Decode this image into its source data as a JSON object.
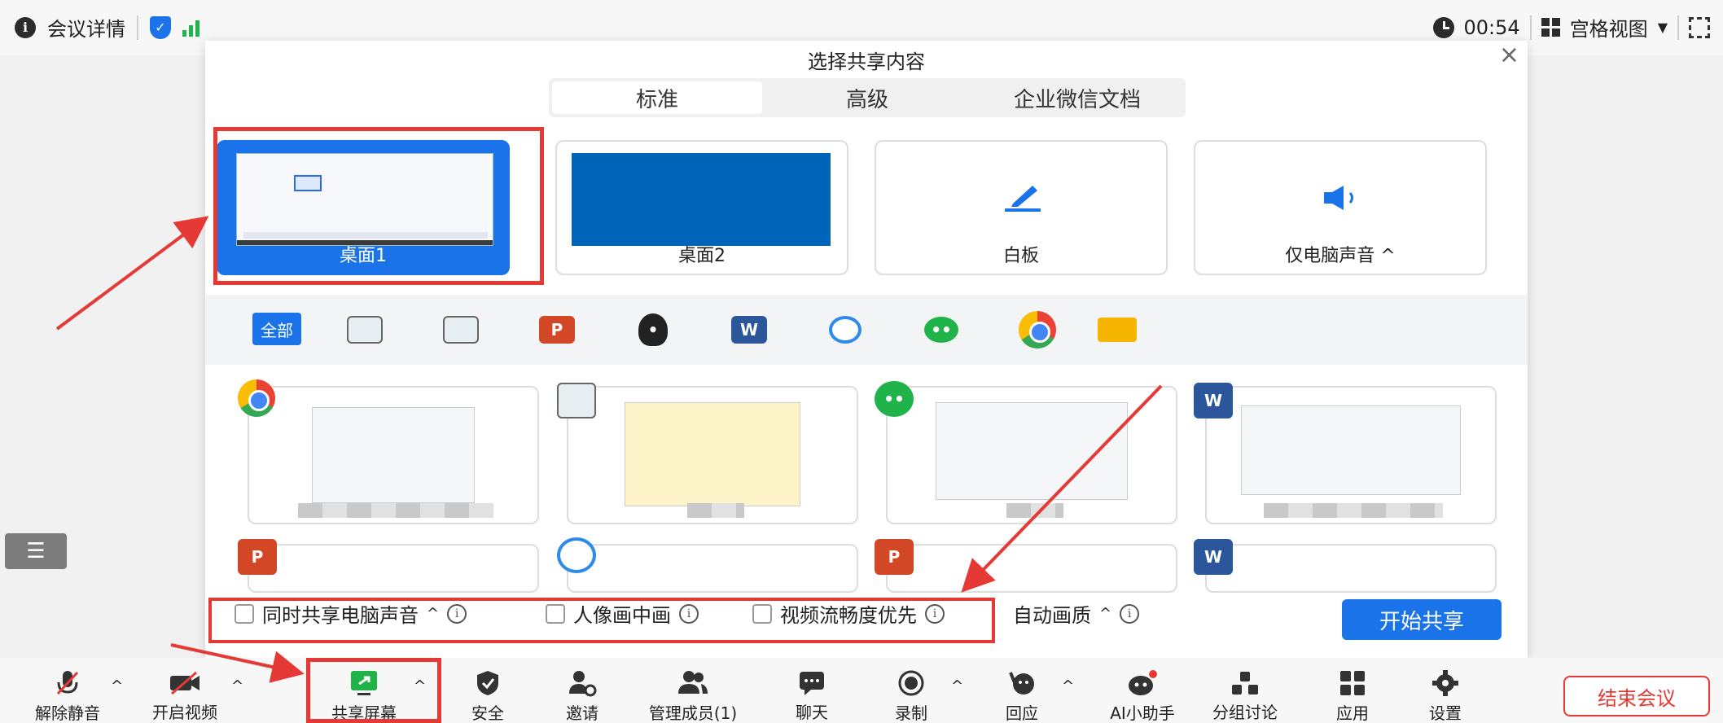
{
  "topbar": {
    "meeting_details": "会议详情",
    "timer": "00:54",
    "view_mode": "宫格视图"
  },
  "dialog": {
    "title": "选择共享内容",
    "tabs": [
      {
        "label": "标准",
        "active": true
      },
      {
        "label": "高级",
        "active": false
      },
      {
        "label": "企业微信文档",
        "active": false
      }
    ],
    "screens": [
      {
        "label": "桌面1",
        "selected": true
      },
      {
        "label": "桌面2",
        "selected": false
      },
      {
        "label": "白板",
        "selected": false
      },
      {
        "label": "仅电脑声音 ^",
        "selected": false
      }
    ],
    "filter_all": "全部",
    "filter_apps": [
      "window-icon",
      "window-icon",
      "powerpoint-icon",
      "qq-icon",
      "word-icon",
      "wecom-icon",
      "wechat-icon",
      "chrome-icon",
      "folder-icon"
    ],
    "options": {
      "share_sound": "同时共享电脑声音",
      "picture_in_picture": "人像画中画",
      "smooth_video": "视频流畅度优先",
      "auto_quality": "自动画质"
    },
    "start_share": "开始共享"
  },
  "toolbar": {
    "items": [
      {
        "label": "解除静音"
      },
      {
        "label": "开启视频"
      },
      {
        "label": "共享屏幕"
      },
      {
        "label": "安全"
      },
      {
        "label": "邀请"
      },
      {
        "label": "管理成员(1)"
      },
      {
        "label": "聊天"
      },
      {
        "label": "录制"
      },
      {
        "label": "回应"
      },
      {
        "label": "AI小助手"
      },
      {
        "label": "分组讨论"
      },
      {
        "label": "应用"
      },
      {
        "label": "设置"
      }
    ],
    "end_meeting": "结束会议"
  },
  "colors": {
    "accent": "#1a73e8",
    "annotation_red": "#e53935",
    "signal_green": "#20b34a"
  }
}
